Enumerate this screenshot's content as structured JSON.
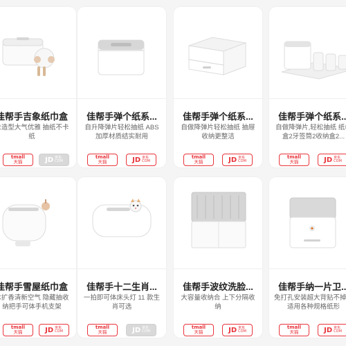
{
  "colors": {
    "accent": "#e8333a",
    "disabled": "#d9d9d9",
    "page_bg": "#f5f5f5"
  },
  "row1": [
    {
      "title": "佳帮手吉象纸巾盒",
      "desc": "象造型大气优雅 抽纸不卡纸",
      "jd_enabled": false
    },
    {
      "title": "佳帮手弹个纸系...",
      "desc": "自升降弹片轻松抽纸 ABS加厚材质结实耐用",
      "jd_enabled": true
    },
    {
      "title": "佳帮手弹个纸系...",
      "desc": "自做降弹片轻松抽纸 抽屉收纳更整洁",
      "jd_enabled": true
    },
    {
      "title": "佳帮手弹个纸系...",
      "desc": "自做降弹片,轻松抽纸 纸巾盒2牙签筒2收纳盒2...",
      "jd_enabled": true
    }
  ],
  "row2": [
    {
      "title": "佳帮手雪屋纸巾盒",
      "desc": "木扩香清新空气 隐藏抽收纳把手可体手机支架",
      "jd_enabled": true
    },
    {
      "title": "佳帮手十二生肖...",
      "desc": "一拍即可体床头灯 11 款生肖可选",
      "jd_enabled": false
    },
    {
      "title": "佳帮手波纹洗脸...",
      "desc": "大容量收纳合 上下分隔收纳",
      "jd_enabled": true
    },
    {
      "title": "佳帮手纳一片卫...",
      "desc": "免打孔安装超大背贴不掉落 适用各种规格纸形",
      "jd_enabled": true
    }
  ],
  "buttons": {
    "tmall_brand": "tmall",
    "tmall_label": "天猫",
    "jd_big": "JD",
    "jd_small_1": "京东",
    "jd_small_2": "COM"
  }
}
